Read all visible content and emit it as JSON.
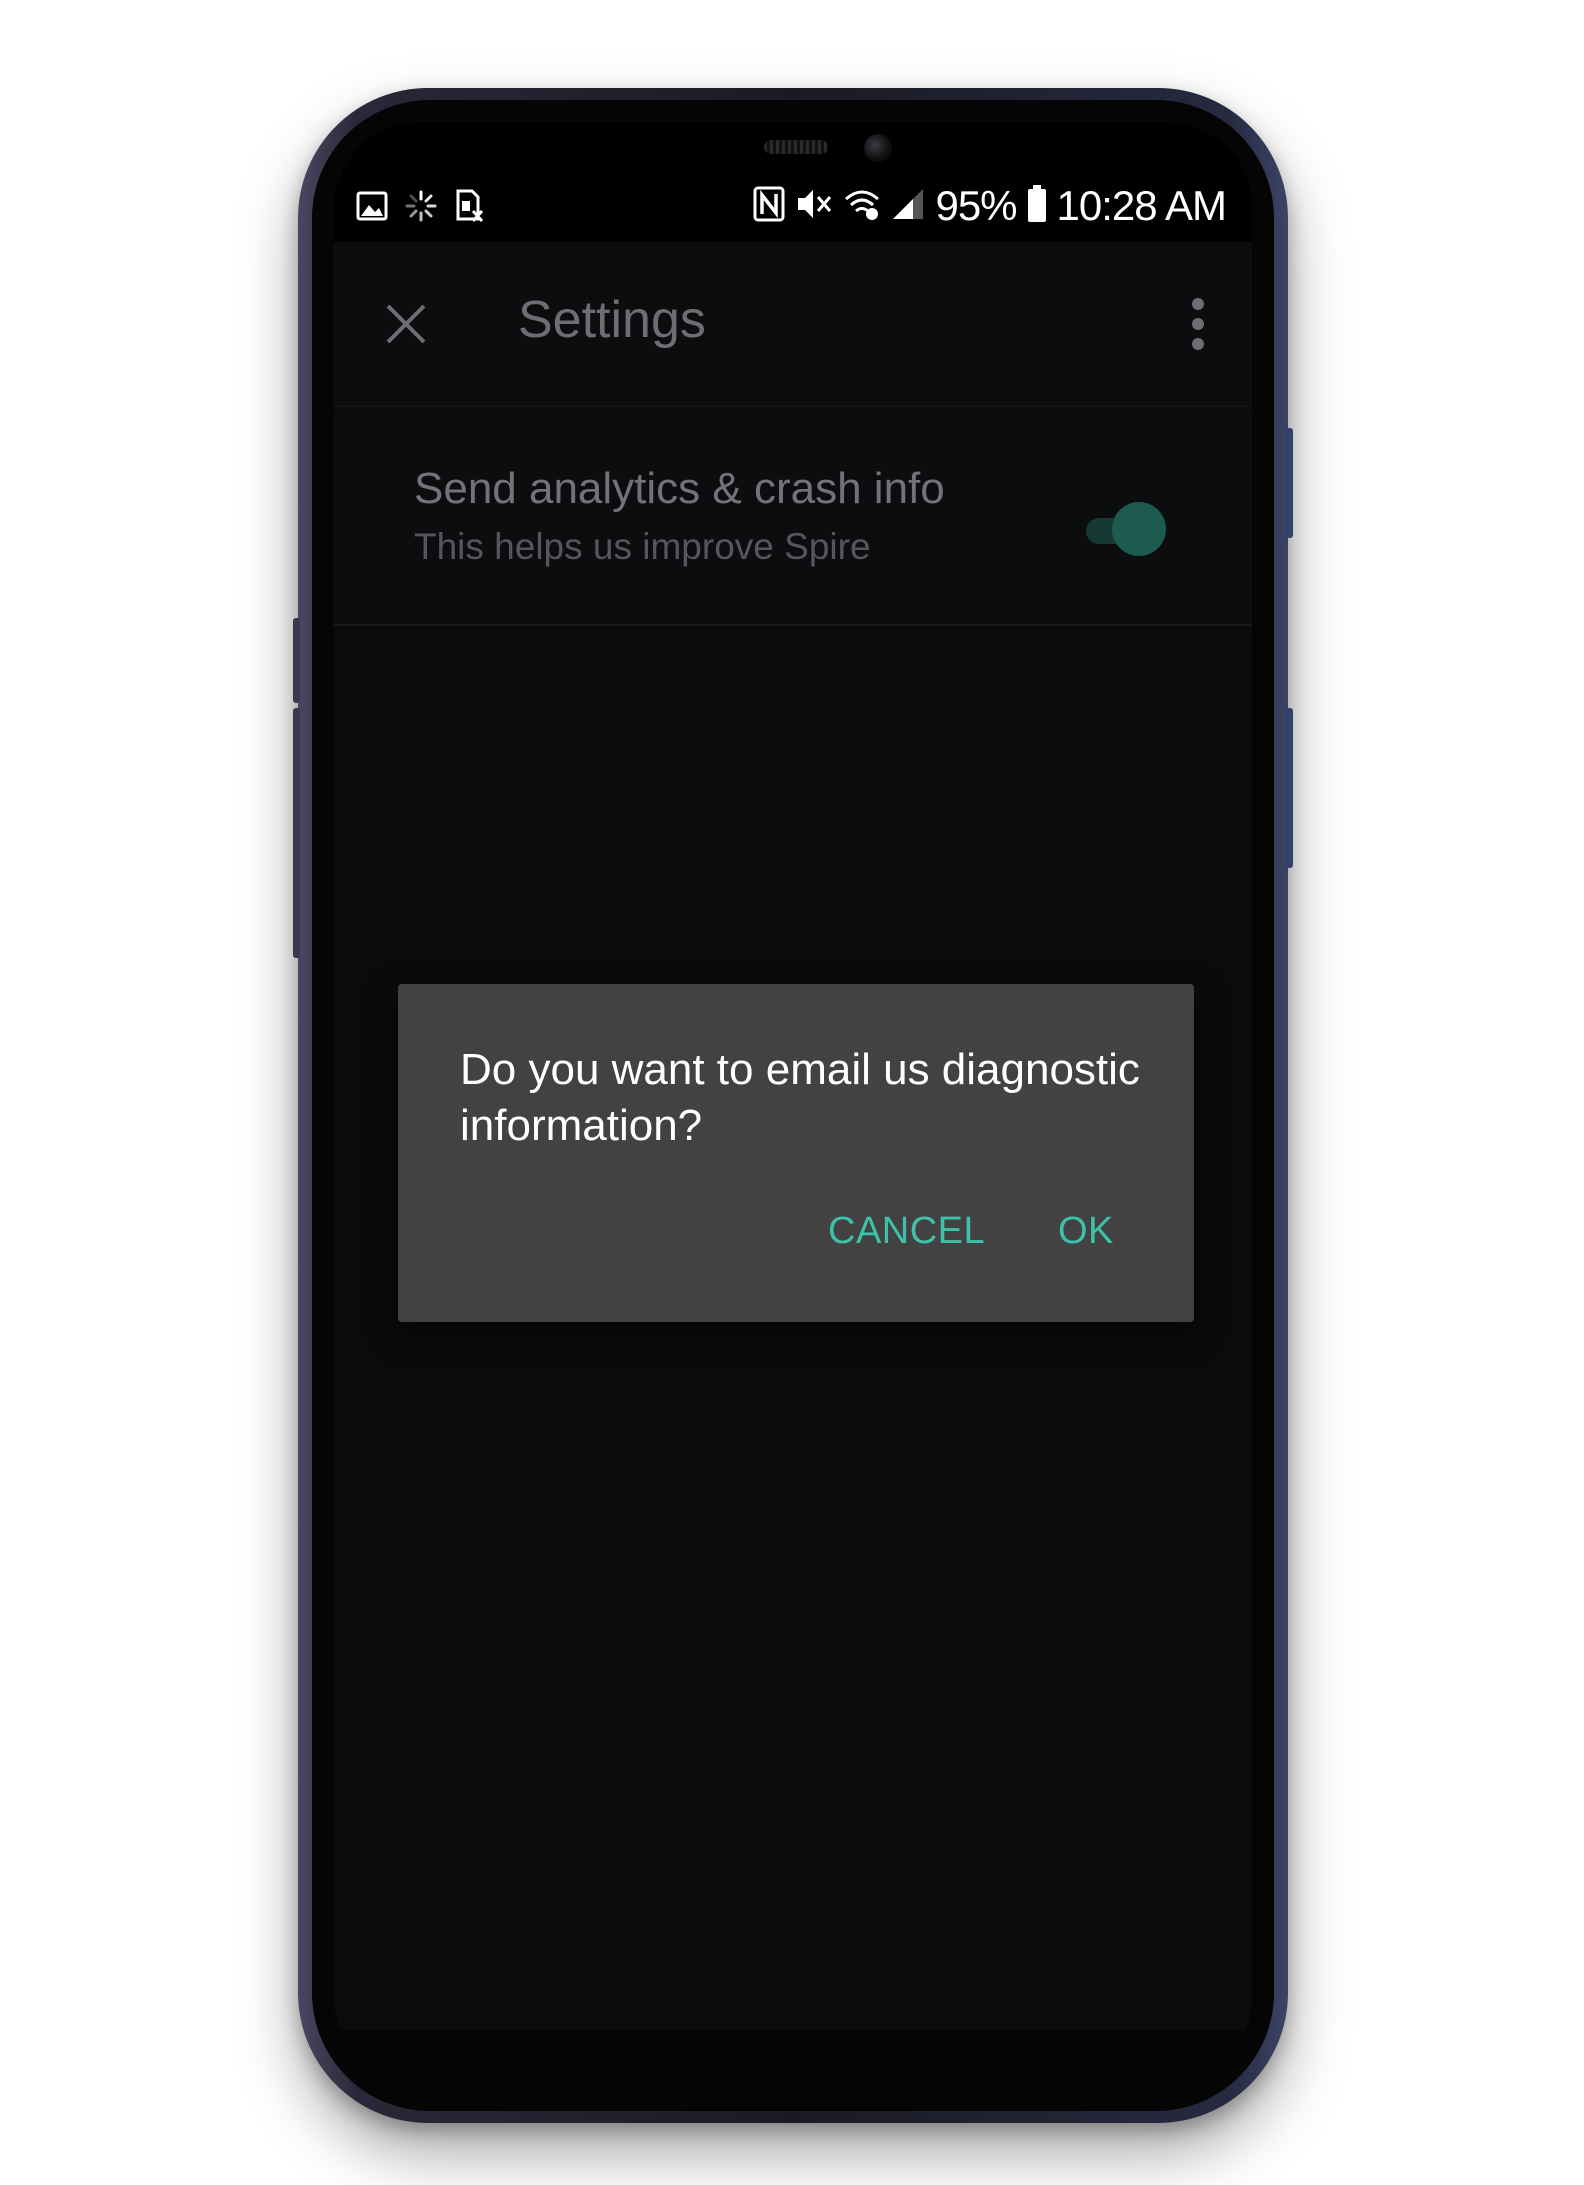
{
  "status_bar": {
    "battery": "95%",
    "time": "10:28 AM",
    "left_icons": [
      "image-icon",
      "loading-icon",
      "sim-card-icon"
    ],
    "right_icons": [
      "nfc-icon",
      "mute-icon",
      "wifi-calling-icon",
      "signal-icon",
      "battery-icon"
    ]
  },
  "app_bar": {
    "title": "Settings",
    "close_icon": "close-icon",
    "menu_icon": "more-vertical-icon"
  },
  "settings": {
    "items": [
      {
        "title": "Send analytics & crash info",
        "subtitle": "This helps us improve Spire",
        "enabled": true
      }
    ]
  },
  "dialog": {
    "message": "Do you want to email us diagnostic information?",
    "cancel_label": "CANCEL",
    "ok_label": "OK"
  },
  "colors": {
    "accent": "#3ec1a8",
    "dialog_bg": "#424242",
    "screen_bg": "#0a0b0d"
  }
}
